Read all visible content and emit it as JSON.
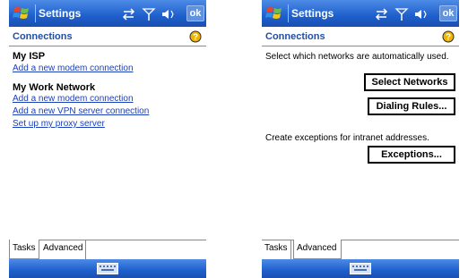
{
  "colors": {
    "titlebar": "#1f5fcc",
    "header_text": "#1e4fa8",
    "link": "#1a3fb6"
  },
  "left": {
    "title": "Settings",
    "ok_label": "ok",
    "header": "Connections",
    "groups": [
      {
        "title": "My ISP",
        "links": [
          "Add a new modem connection"
        ]
      },
      {
        "title": "My Work Network",
        "links": [
          "Add a new modem connection",
          "Add a new VPN server connection",
          "Set up my proxy server"
        ]
      }
    ],
    "tabs": [
      "Tasks",
      "Advanced"
    ],
    "active_tab": "Tasks"
  },
  "right": {
    "title": "Settings",
    "ok_label": "ok",
    "header": "Connections",
    "text1": "Select which networks are automatically used.",
    "btn_select_networks": "Select Networks",
    "btn_dialing_rules": "Dialing Rules...",
    "text2": "Create exceptions for intranet addresses.",
    "btn_exceptions": "Exceptions...",
    "tabs": [
      "Tasks",
      "Advanced"
    ],
    "active_tab": "Advanced"
  },
  "icons": [
    "windows-flag-icon",
    "connectivity-icon",
    "signal-icon",
    "volume-icon",
    "help-icon",
    "keyboard-icon"
  ]
}
